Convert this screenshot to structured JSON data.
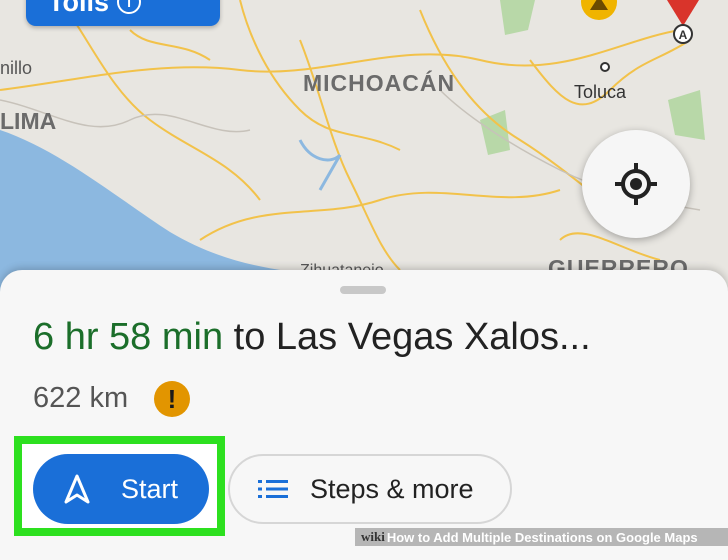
{
  "map": {
    "labels": {
      "michoacan": "MICHOACÁN",
      "toluca": "Toluca",
      "lima": "LIMA",
      "nillo": "nillo",
      "zihuatanejo": "Zihuatanejo",
      "guerrero": "GUERRERO",
      "pin_letter": "A"
    },
    "colors": {
      "land": "#e8e6e1",
      "water": "#8cb8e0",
      "roads": "#f2c24a",
      "parks": "#b8d8a8"
    }
  },
  "tolls_button": {
    "label": "Tolls",
    "icon": "info-icon",
    "info_glyph": "i"
  },
  "locate_button": {
    "icon": "my-location-icon"
  },
  "route": {
    "duration": "6 hr 58 min",
    "destination": "to Las Vegas Xalos...",
    "distance": "622 km",
    "warning_icon": "!"
  },
  "actions": {
    "start_label": "Start",
    "start_icon": "navigation-arrow-icon",
    "steps_label": "Steps & more",
    "steps_icon": "list-icon"
  },
  "watermark": {
    "wiki": "wiki",
    "text": "How to Add Multiple Destinations on Google Maps"
  },
  "colors": {
    "accent_blue": "#1a6fd8",
    "duration_green": "#1b6e2a",
    "highlight_green": "#2de01f",
    "warning_orange": "#e29500"
  }
}
